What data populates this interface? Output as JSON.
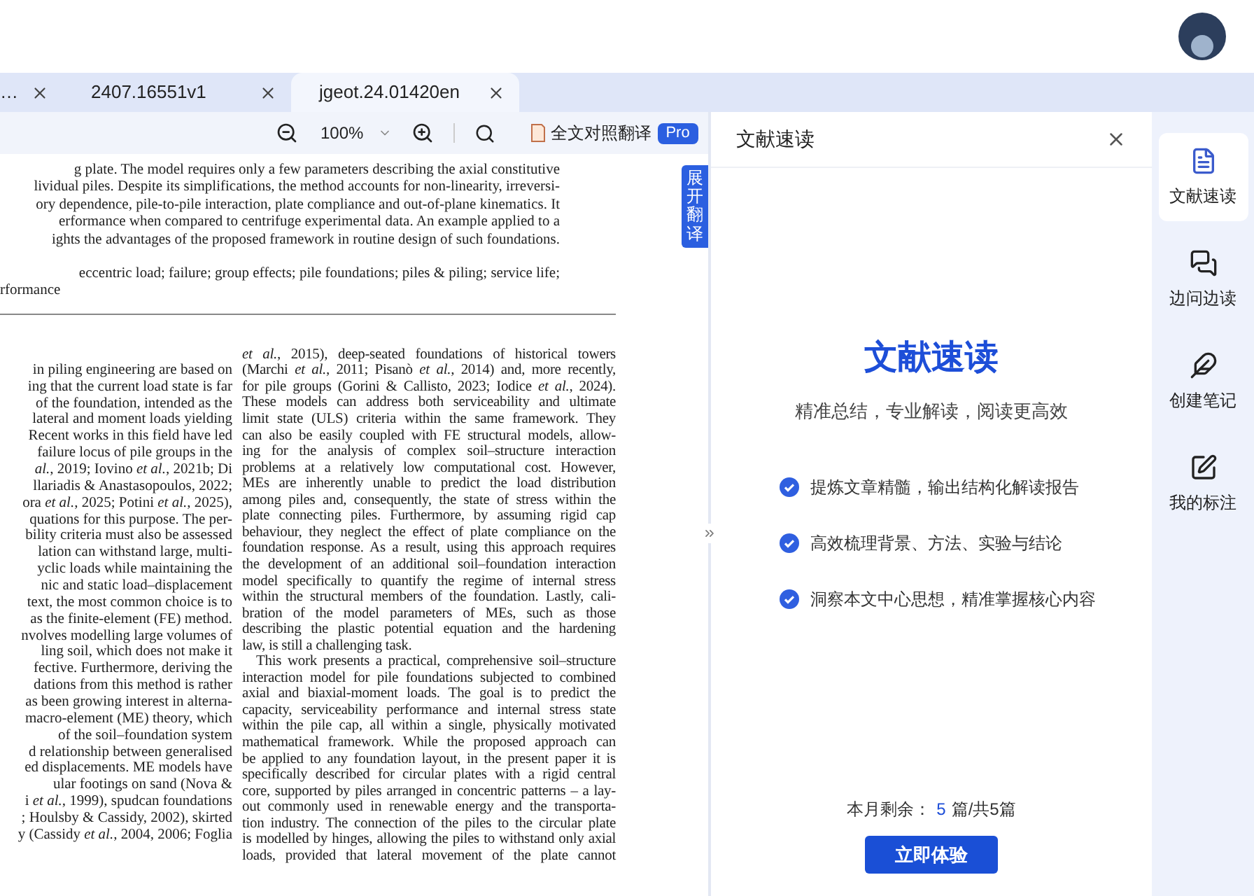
{
  "tabs": [
    {
      "label": "…",
      "selected": false
    },
    {
      "label": "2407.16551v1",
      "selected": false
    },
    {
      "label": "jgeot.24.01420en",
      "selected": true
    }
  ],
  "toolbar": {
    "zoom": "100%",
    "translate_label": "全文对照翻译",
    "badge": "Pro"
  },
  "translate_toggle": "展开翻译",
  "document": {
    "abstract_lines": [
      "g plate. The model requires only a few parameters describing the axial constitutive",
      "lividual piles. Despite its simplifications, the method accounts for non-linearity, irreversi-",
      "ory dependence, pile-to-pile interaction, plate compliance and out-of-plane kinematics. It",
      "erformance when compared to centrifuge experimental data. An example applied to a",
      "ights the advantages of the proposed framework in routine design of such foundations."
    ],
    "keyword_lines": [
      "eccentric load; failure; group effects; pile foundations; piles & piling; service life;",
      "rformance"
    ],
    "left_column": [
      "in piling engineering are based on",
      "ing that the current load state is far",
      "of the foundation, intended as the",
      "lateral and moment loads yielding",
      "Recent works in this field have led",
      "failure locus of pile groups in the",
      "*al.*, 2019; Iovino *et al.*, 2021b; Di",
      "llariadis & Anastasopoulos, 2022;",
      "ora *et al.*, 2025; Potini *et al.*, 2025),",
      "quations for this purpose. The per-",
      "bility criteria must also be assessed",
      "lation can withstand large, multi-",
      "yclic loads while maintaining the",
      "nic and static load–displacement",
      "text, the most common choice is to",
      "as the finite-element (FE) method.",
      "nvolves modelling large volumes of",
      "ling soil, which does not make it",
      "fective. Furthermore, deriving the",
      "dations from this method is rather",
      "as been growing interest in alterna-",
      "macro-element (ME) theory, which",
      "of the soil–foundation system",
      "d relationship between generalised",
      "ed displacements. ME models have",
      "ular footings on sand (Nova &",
      "i *et al.*, 1999), spudcan foundations",
      "; Houlsby & Cassidy, 2002), skirted",
      "y (Cassidy *et al.*, 2004, 2006; Foglia"
    ],
    "right_column": [
      {
        "kind": "line",
        "text": "*et al.*, 2015), deep-seated foundations of historical towers"
      },
      {
        "kind": "line",
        "text": "(Marchi *et al.*, 2011; Pisanò *et al.*, 2014) and, more recently,"
      },
      {
        "kind": "line",
        "text": "for pile groups (Gorini & Callisto, 2023; Iodice *et al.*, 2024)."
      },
      {
        "kind": "line",
        "text": "These models can address both serviceability and ultimate"
      },
      {
        "kind": "line",
        "text": "limit state (ULS) criteria within the same framework. They"
      },
      {
        "kind": "line",
        "text": "can also be easily coupled with FE structural models, allow-"
      },
      {
        "kind": "line",
        "text": "ing for the analysis of complex soil–structure interaction"
      },
      {
        "kind": "line",
        "text": "problems at a relatively low computational cost. However,"
      },
      {
        "kind": "line",
        "text": "MEs are inherently unable to predict the load distribution"
      },
      {
        "kind": "line",
        "text": "among piles and, consequently, the state of stress within the"
      },
      {
        "kind": "line",
        "text": "plate connecting piles. Furthermore, by assuming rigid cap"
      },
      {
        "kind": "line",
        "text": "behaviour, they neglect the effect of plate compliance on the"
      },
      {
        "kind": "line",
        "text": "foundation response. As a result, using this approach requires"
      },
      {
        "kind": "line",
        "text": "the development of an additional soil–foundation interaction"
      },
      {
        "kind": "line",
        "text": "model specifically to quantify the regime of internal stress"
      },
      {
        "kind": "line",
        "text": "within the structural members of the foundation. Lastly, cali-"
      },
      {
        "kind": "line",
        "text": "bration of the model parameters of MEs, such as those"
      },
      {
        "kind": "line",
        "text": "describing the plastic potential equation and the hardening"
      },
      {
        "kind": "end",
        "text": "law, is still a challenging task."
      },
      {
        "kind": "indent",
        "text": "This work presents a practical, comprehensive soil–structure"
      },
      {
        "kind": "line",
        "text": "interaction model for pile foundations subjected to combined"
      },
      {
        "kind": "line",
        "text": "axial and biaxial-moment loads. The goal is to predict the"
      },
      {
        "kind": "line",
        "text": "capacity, serviceability performance and internal stress state"
      },
      {
        "kind": "line",
        "text": "within the pile cap, all within a single, physically motivated"
      },
      {
        "kind": "line",
        "text": "mathematical framework. While the proposed approach can"
      },
      {
        "kind": "line",
        "text": "be applied to any foundation layout, in the present paper it is"
      },
      {
        "kind": "line",
        "text": "specifically described for circular plates with a rigid central"
      },
      {
        "kind": "line",
        "text": "core, supported by piles arranged in concentric patterns – a lay-"
      },
      {
        "kind": "line",
        "text": "out commonly used in renewable energy and the transporta-"
      },
      {
        "kind": "line",
        "text": "tion industry. The connection of the piles to the circular plate"
      },
      {
        "kind": "line",
        "text": "is modelled by hinges, allowing the piles to withstand only axial"
      },
      {
        "kind": "line",
        "text": "loads, provided that lateral movement of the plate cannot"
      }
    ]
  },
  "panel": {
    "header": "文献速读",
    "title": "文献速读",
    "subtitle": "精准总结，专业解读，阅读更高效",
    "features": [
      "提炼文章精髓，输出结构化解读报告",
      "高效梳理背景、方法、实验与结论",
      "洞察本文中心思想，精准掌握核心内容"
    ],
    "quota": {
      "label": "本月剩余：",
      "count": "5",
      "total": "篇/共5篇"
    },
    "button": "立即体验"
  },
  "rail": [
    {
      "kind": "quick-read",
      "label": "文献速读",
      "selected": true
    },
    {
      "kind": "chat",
      "label": "边问边读",
      "selected": false
    },
    {
      "kind": "note",
      "label": "创建笔记",
      "selected": false
    },
    {
      "kind": "mark",
      "label": "我的标注",
      "selected": false
    }
  ]
}
